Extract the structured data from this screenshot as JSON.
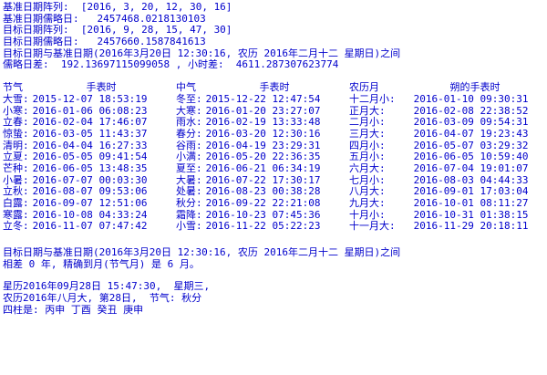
{
  "header": {
    "base_array": "基准日期阵列:  [2016, 3, 20, 12, 30, 16]",
    "base_jd": "基准日期儒略日:   2457468.0218130103",
    "target_array": "目标日期阵列:  [2016, 9, 28, 15, 47, 30]",
    "target_jd": "目标日期儒略日:   2457660.1587841613",
    "between": "目标日期与基准日期(2016年3月20日 12:30:16, 农历 2016年二月十二 星期日)之间",
    "diff": "儒略日差:  192.13697115099058 , 小时差:  4611.287307623774"
  },
  "table": {
    "headers": [
      "节气",
      "手表时",
      "中气",
      "手表时",
      "农历月",
      "朔的手表时"
    ],
    "rows": [
      [
        "大雪:",
        " 2015-12-07 18:53:19",
        "冬至:",
        " 2015-12-22 12:47:54",
        "十二月小:",
        " 2016-01-10 09:30:31"
      ],
      [
        "小寒:",
        " 2016-01-06 06:08:23",
        "大寒:",
        " 2016-01-20 23:27:07",
        "正月大:",
        " 2016-02-08 22:38:52"
      ],
      [
        "立春:",
        " 2016-02-04 17:46:07",
        "雨水:",
        " 2016-02-19 13:33:48",
        "二月小:",
        " 2016-03-09 09:54:31"
      ],
      [
        "惊蛰:",
        " 2016-03-05 11:43:37",
        "春分:",
        " 2016-03-20 12:30:16",
        "三月大:",
        " 2016-04-07 19:23:43"
      ],
      [
        "清明:",
        " 2016-04-04 16:27:33",
        "谷雨:",
        " 2016-04-19 23:29:31",
        "四月小:",
        " 2016-05-07 03:29:32"
      ],
      [
        "立夏:",
        " 2016-05-05 09:41:54",
        "小满:",
        " 2016-05-20 22:36:35",
        "五月小:",
        " 2016-06-05 10:59:40"
      ],
      [
        "芒种:",
        " 2016-06-05 13:48:35",
        "夏至:",
        " 2016-06-21 06:34:19",
        "六月大:",
        " 2016-07-04 19:01:07"
      ],
      [
        "小暑:",
        " 2016-07-07 00:03:30",
        "大暑:",
        " 2016-07-22 17:30:17",
        "七月小:",
        " 2016-08-03 04:44:33"
      ],
      [
        "立秋:",
        " 2016-08-07 09:53:06",
        "处暑:",
        " 2016-08-23 00:38:28",
        "八月大:",
        " 2016-09-01 17:03:04"
      ],
      [
        "白露:",
        " 2016-09-07 12:51:06",
        "秋分:",
        " 2016-09-22 22:21:08",
        "九月大:",
        " 2016-10-01 08:11:27"
      ],
      [
        "寒露:",
        " 2016-10-08 04:33:24",
        "霜降:",
        " 2016-10-23 07:45:36",
        "十月小:",
        " 2016-10-31 01:38:15"
      ],
      [
        "立冬:",
        " 2016-11-07 07:47:42",
        "小雪:",
        " 2016-11-22 05:22:23",
        "十一月大:",
        " 2016-11-29 20:18:11"
      ]
    ]
  },
  "footer": {
    "between": "目标日期与基准日期(2016年3月20日 12:30:16, 农历 2016年二月十二 星期日)之间",
    "diff": "相差 0 年, 精确到月(节气月) 是 6 月。",
    "gregorian": "星历2016年09月28日 15:47:30,  星期三,",
    "lunar": "农历2016年八月大, 第28日,  节气: 秋分",
    "pillars": "四柱是: 丙申 丁酉 癸丑 庚申"
  }
}
